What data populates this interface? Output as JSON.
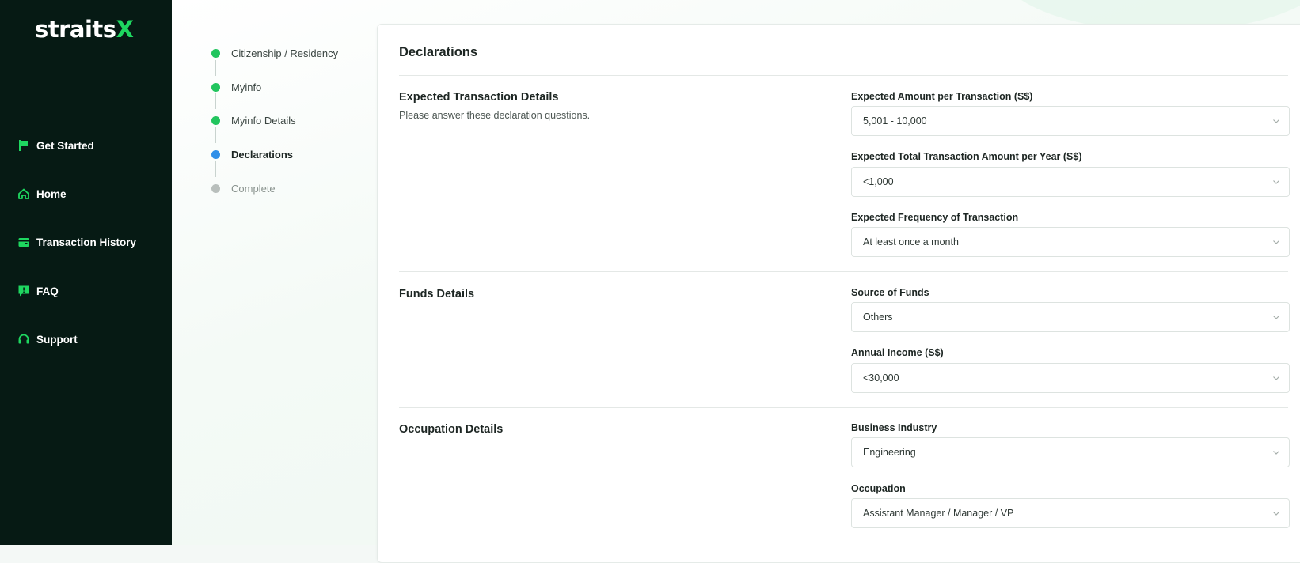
{
  "brand": {
    "logo_main": "straits",
    "logo_accent": "X"
  },
  "sidebar": {
    "items": [
      {
        "label": "Get Started",
        "icon": "flag-icon"
      },
      {
        "label": "Home",
        "icon": "home-icon"
      },
      {
        "label": "Transaction History",
        "icon": "wallet-icon"
      },
      {
        "label": "FAQ",
        "icon": "faq-icon"
      },
      {
        "label": "Support",
        "icon": "headset-icon"
      }
    ]
  },
  "steps": [
    {
      "label": "Citizenship / Residency",
      "status": "done"
    },
    {
      "label": "Myinfo",
      "status": "done"
    },
    {
      "label": "Myinfo Details",
      "status": "done"
    },
    {
      "label": "Declarations",
      "status": "current"
    },
    {
      "label": "Complete",
      "status": "pending"
    }
  ],
  "colors": {
    "sidebar_bg": "#061a14",
    "accent_green": "#1ed760",
    "step_done": "#22c55e",
    "step_current": "#2f8fe8",
    "step_pending": "#b9bfbc"
  },
  "card": {
    "title": "Declarations",
    "sections": {
      "transaction": {
        "title": "Expected Transaction Details",
        "subtitle": "Please answer these declaration questions.",
        "fields": [
          {
            "label": "Expected Amount per Transaction (S$)",
            "value": "5,001 - 10,000"
          },
          {
            "label": "Expected Total Transaction Amount per Year (S$)",
            "value": "<1,000"
          },
          {
            "label": "Expected Frequency of Transaction",
            "value": "At least once a month"
          }
        ]
      },
      "funds": {
        "title": "Funds Details",
        "fields": [
          {
            "label": "Source of Funds",
            "value": "Others"
          },
          {
            "label": "Annual Income (S$)",
            "value": "<30,000"
          }
        ]
      },
      "occupation": {
        "title": "Occupation Details",
        "fields": [
          {
            "label": "Business Industry",
            "value": "Engineering"
          },
          {
            "label": "Occupation",
            "value": "Assistant Manager / Manager / VP"
          }
        ]
      }
    }
  }
}
